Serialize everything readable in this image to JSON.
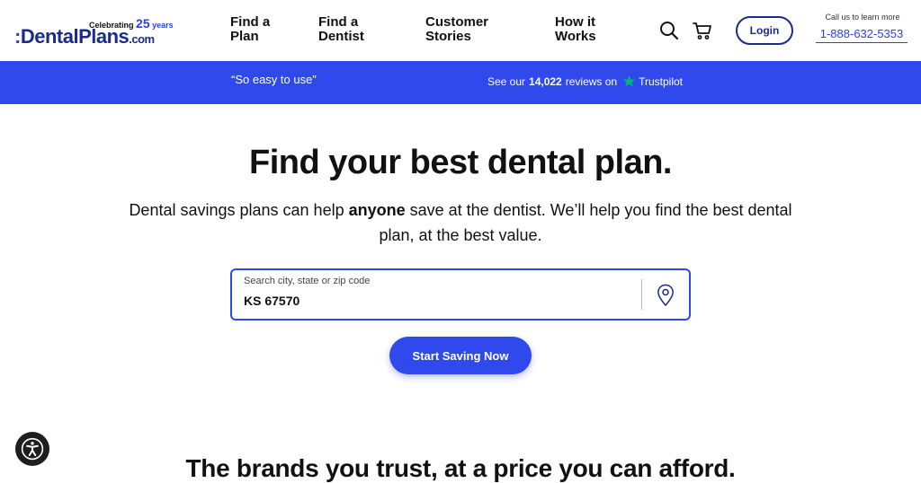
{
  "header": {
    "logo": {
      "celebrating": "Celebrating",
      "years_number": "25",
      "years_word": "years",
      "brand_colon": ":",
      "brand_name": "DentalPlans",
      "brand_suffix": ".com"
    },
    "nav": [
      {
        "line1": "Find a",
        "line2": "Plan"
      },
      {
        "line1": "Find a",
        "line2": "Dentist"
      },
      {
        "line1": "Customer",
        "line2": "Stories"
      },
      {
        "line1": "How it",
        "line2": "Works"
      }
    ],
    "icons": {
      "search": "search-icon",
      "cart": "cart-icon"
    },
    "login_label": "Login",
    "call_label": "Call us to learn more",
    "phone": "1-888-632-5353"
  },
  "banner": {
    "quote": "“So easy to use”",
    "reviews_prefix": "See our",
    "reviews_count": "14,022",
    "reviews_suffix": "reviews on",
    "trustpilot": "Trustpilot",
    "accent_color": "#2f49ec",
    "star_color": "#00b67a"
  },
  "hero": {
    "title": "Find your best dental plan.",
    "subtitle_before": "Dental savings plans can help ",
    "subtitle_bold": "anyone",
    "subtitle_after": " save at the dentist. We’ll help you find the best dental plan, at the best value.",
    "search": {
      "label": "Search city, state or zip code",
      "value": "KS 67570"
    },
    "cta_label": "Start Saving Now"
  },
  "brands_title": "The brands you trust, at a price you can afford."
}
